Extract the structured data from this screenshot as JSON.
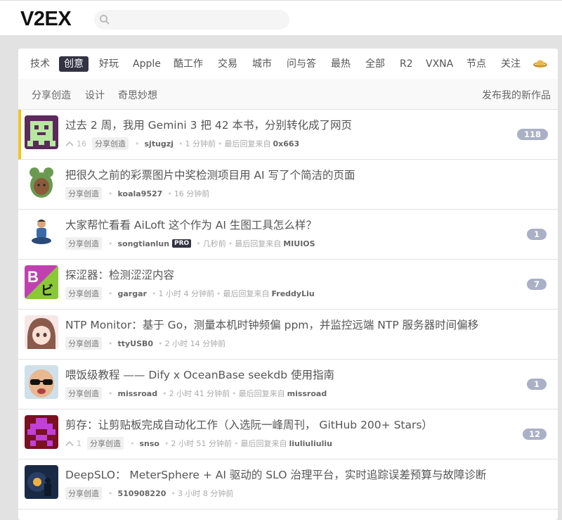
{
  "header": {
    "logo": "V2EX",
    "search": {
      "value": "",
      "placeholder": ""
    }
  },
  "tabs": [
    "技术",
    "创意",
    "好玩",
    "Apple",
    "酷工作",
    "交易",
    "城市",
    "问与答",
    "最热",
    "全部",
    "R2",
    "VXNA",
    "节点",
    "关注"
  ],
  "active_tab": "创意",
  "tab_icon": "planet-icon",
  "subnav": {
    "links": [
      "分享创造",
      "设计",
      "奇思妙想"
    ],
    "action": "发布我的新作品"
  },
  "topics": [
    {
      "title": "过去 2 周，我用 Gemini 3 把 42 本书，分别转化成了网页",
      "votes": "16",
      "node": "分享创造",
      "user": "sjtugzj",
      "time": "1 分钟前",
      "last_reply_label": "最后回复来自",
      "last_reply": "0x663",
      "replies": "118",
      "avatar": "pixel-invader-avatar",
      "hot": true
    },
    {
      "title": "把很久之前的彩票图片中奖检测项目用 AI 写了个简洁的页面",
      "node": "分享创造",
      "user": "koala9527",
      "time": "16 分钟前",
      "avatar": "frog-hood-avatar"
    },
    {
      "title": "大家帮忙看看 AiLoft 这个作为 AI 生图工具怎么样？",
      "node": "分享创造",
      "user": "songtianlun",
      "badge": "PRO",
      "time": "几秒前",
      "last_reply_label": "最后回复来自",
      "last_reply": "MIUIOS",
      "replies": "1",
      "avatar": "sitting-person-avatar"
    },
    {
      "title": "探涩器：检测涩涩内容",
      "node": "分享创造",
      "user": "gargar",
      "time": "1 小时 4 分钟前",
      "last_reply_label": "最后回复来自",
      "last_reply": "FreddyLiu",
      "replies": "7",
      "avatar": "b-bi-logo-avatar"
    },
    {
      "title": "NTP Monitor：基于 Go，测量本机时钟频偏 ppm，并监控远端 NTP 服务器时间偏移",
      "node": "分享创造",
      "user": "ttyUSB0",
      "time": "2 小时 14 分钟前",
      "avatar": "anime-girl-avatar"
    },
    {
      "title": "喂饭级教程 —— Dify x OceanBase seekdb 使用指南",
      "node": "分享创造",
      "user": "missroad",
      "time": "2 小时 41 分钟前",
      "last_reply_label": "最后回复来自",
      "last_reply": "missroad",
      "replies": "1",
      "avatar": "baby-sunglasses-avatar"
    },
    {
      "title": "剪存：让剪贴板完成自动化工作（入选阮一峰周刊， GitHub 200+ Stars）",
      "votes": "1",
      "node": "分享创造",
      "user": "snso",
      "time": "2 小时 51 分钟前",
      "last_reply_label": "最后回复来自",
      "last_reply": "liuliuliuliu",
      "replies": "12",
      "avatar": "pixel-purple-avatar"
    },
    {
      "title": "DeepSLO： MeterSphere + AI 驱动的 SLO 治理平台，实时追踪误差预算与故障诊断",
      "node": "分享创造",
      "user": "510908220",
      "time": "3 小时 8 分钟前",
      "avatar": "night-lantern-avatar"
    }
  ],
  "colors": {
    "count_badge": "#aab0c6",
    "active_tab": "#334",
    "hot_bar": "#f5c518"
  }
}
